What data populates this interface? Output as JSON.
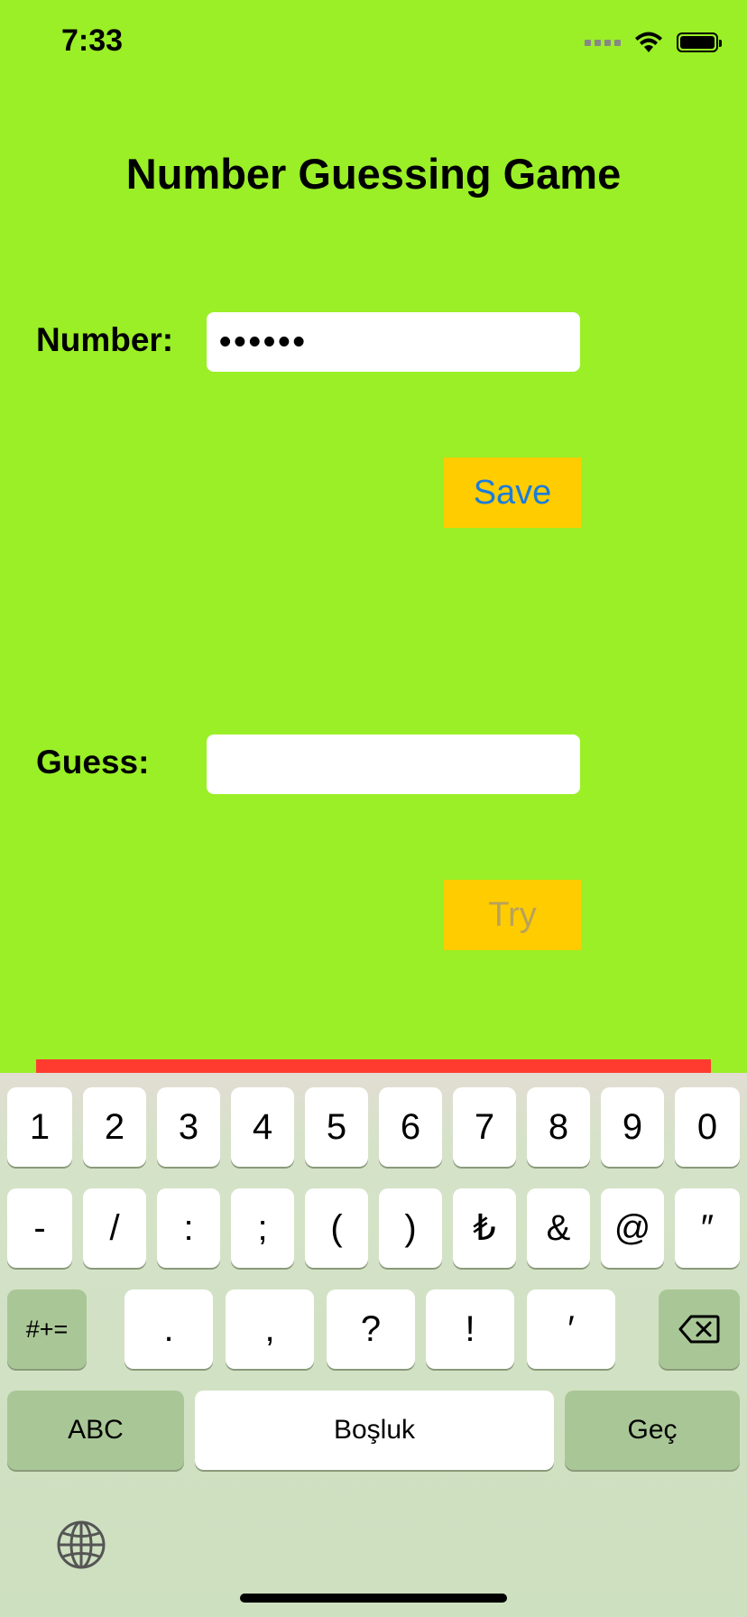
{
  "status": {
    "time": "7:33"
  },
  "title": "Number Guessing Game",
  "number_label": "Number:",
  "number_value": "••••••",
  "save_label": "Save",
  "guess_label": "Guess:",
  "guess_value": "",
  "try_label": "Try",
  "colors": {
    "background": "#9aef27",
    "button": "#ffcc00",
    "save_text": "#1a7cdc",
    "try_text": "#b8a25a",
    "bar": "#ff3b30"
  },
  "keyboard": {
    "row1": [
      "1",
      "2",
      "3",
      "4",
      "5",
      "6",
      "7",
      "8",
      "9",
      "0"
    ],
    "row2": [
      "-",
      "/",
      ":",
      ";",
      "(",
      ")",
      "₺",
      "&",
      "@",
      "″"
    ],
    "row3_left": "#+=",
    "row3": [
      ".",
      ",",
      "?",
      "!",
      "′"
    ],
    "abc": "ABC",
    "space": "Boşluk",
    "go": "Geç"
  }
}
